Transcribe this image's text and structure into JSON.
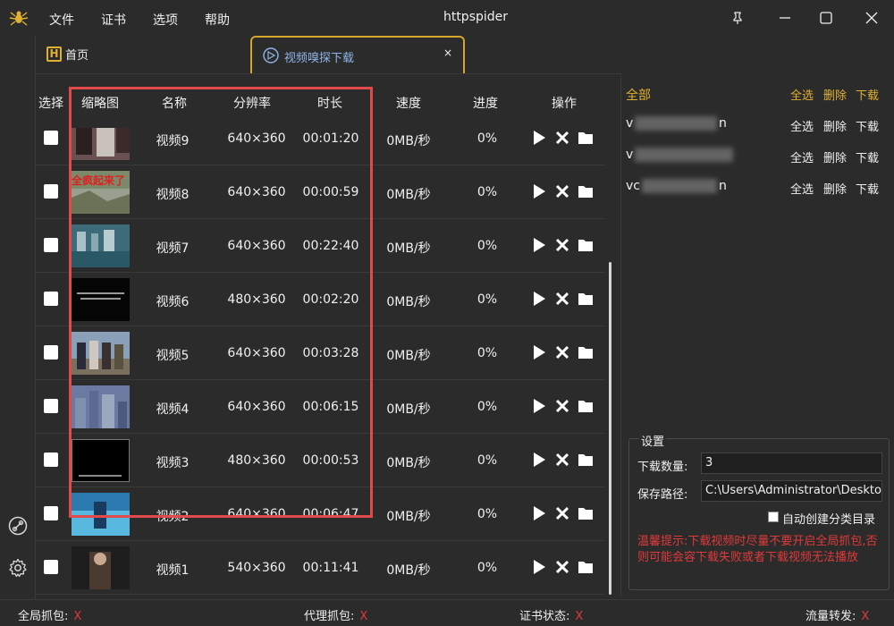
{
  "menu": [
    "文件",
    "证书",
    "选项",
    "帮助"
  ],
  "window_title": "httpspider",
  "tabs": {
    "home": "首页",
    "active": "视频嗅探下载",
    "close": "×"
  },
  "table": {
    "headers": [
      "选择",
      "缩略图",
      "名称",
      "分辨率",
      "时长",
      "速度",
      "进度",
      "操作"
    ],
    "rows": [
      {
        "name": "视频9",
        "res": "640×360",
        "dur": "00:01:20",
        "speed": "0MB/秒",
        "progress": "0%"
      },
      {
        "name": "视频8",
        "res": "640×360",
        "dur": "00:00:59",
        "speed": "0MB/秒",
        "progress": "0%",
        "thumb_text": "全疯起来了"
      },
      {
        "name": "视频7",
        "res": "640×360",
        "dur": "00:22:40",
        "speed": "0MB/秒",
        "progress": "0%"
      },
      {
        "name": "视频6",
        "res": "480×360",
        "dur": "00:02:20",
        "speed": "0MB/秒",
        "progress": "0%"
      },
      {
        "name": "视频5",
        "res": "640×360",
        "dur": "00:03:28",
        "speed": "0MB/秒",
        "progress": "0%"
      },
      {
        "name": "视频4",
        "res": "640×360",
        "dur": "00:06:15",
        "speed": "0MB/秒",
        "progress": "0%"
      },
      {
        "name": "视频3",
        "res": "480×360",
        "dur": "00:00:53",
        "speed": "0MB/秒",
        "progress": "0%"
      },
      {
        "name": "视频2",
        "res": "640×360",
        "dur": "00:06:47",
        "speed": "0MB/秒",
        "progress": "0%"
      },
      {
        "name": "视频1",
        "res": "540×360",
        "dur": "00:11:41",
        "speed": "0MB/秒",
        "progress": "0%"
      }
    ]
  },
  "right_panel": {
    "all_label": "全部",
    "select_all": "全选",
    "delete": "删除",
    "download": "下载",
    "hosts": [
      {
        "prefix": "v",
        "suffix": "n"
      },
      {
        "prefix": "v",
        "suffix": ""
      },
      {
        "prefix": "vc",
        "suffix": "n"
      }
    ]
  },
  "settings": {
    "title": "设置",
    "count_label": "下载数量:",
    "count_value": "3",
    "path_label": "保存路径:",
    "path_value": "C:\\Users\\Administrator\\Desktop\\新",
    "auto_dir_label": "自动创建分类目录",
    "tip": "温馨提示:下载视频时尽量不要开启全局抓包,否则可能会容下载失败或者下载视频无法播放"
  },
  "status": {
    "global_capture": "全局抓包:",
    "proxy_capture": "代理抓包:",
    "cert_status": "证书状态:",
    "traffic_forward": "流量转发:",
    "off": "X"
  },
  "colors": {
    "accent": "#e0b030",
    "tip": "#e03a3a",
    "highlight": "#e04a4a"
  }
}
